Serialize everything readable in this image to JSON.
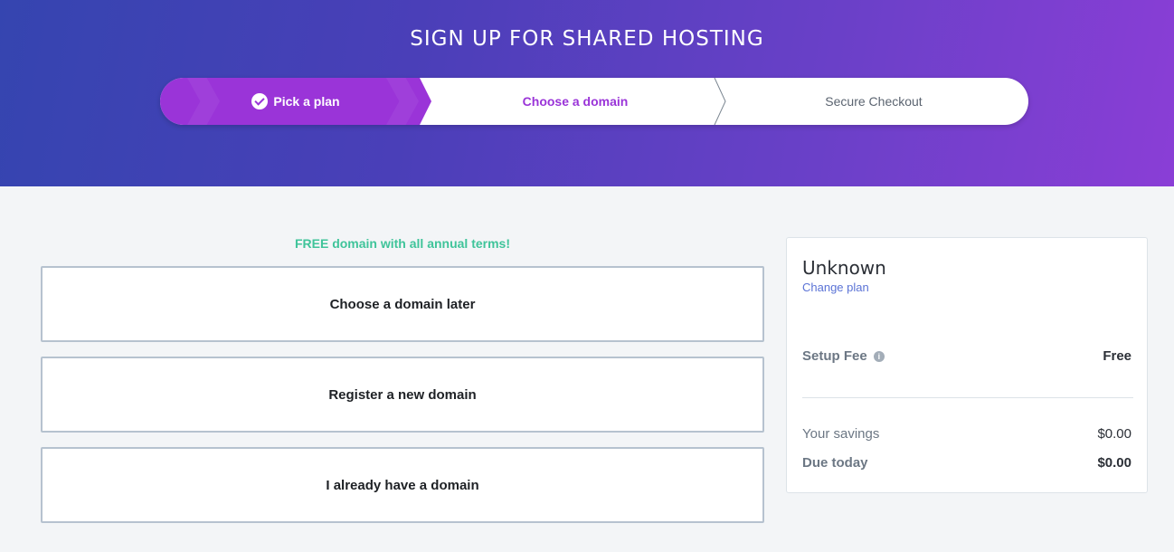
{
  "header": {
    "title": "SIGN UP FOR SHARED HOSTING"
  },
  "stepper": {
    "steps": [
      {
        "label": "Pick a plan",
        "state": "completed"
      },
      {
        "label": "Choose a domain",
        "state": "active"
      },
      {
        "label": "Secure Checkout",
        "state": "upcoming"
      }
    ]
  },
  "domain": {
    "note": "FREE domain with all annual terms!",
    "options": [
      {
        "label": "Choose a domain later"
      },
      {
        "label": "Register a new domain"
      },
      {
        "label": "I already have a domain"
      }
    ]
  },
  "summary": {
    "plan_name": "Unknown",
    "change_plan_link": "Change plan",
    "setup_fee_label": "Setup Fee",
    "setup_fee_info_icon": "info-icon",
    "setup_fee_value": "Free",
    "savings_label": "Your savings",
    "savings_value": "$0.00",
    "due_label": "Due today",
    "due_value": "$0.00"
  },
  "colors": {
    "brand_purple": "#9a34d8",
    "free_green": "#3fc49a",
    "link_blue": "#5b73d6"
  }
}
